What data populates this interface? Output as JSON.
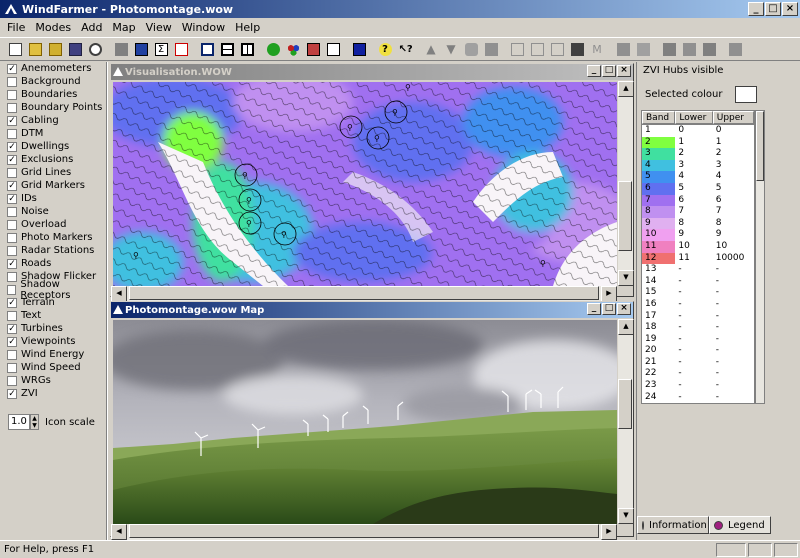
{
  "window": {
    "title": "WindFarmer - Photomontage.wow"
  },
  "menu": [
    "File",
    "Modes",
    "Add",
    "Map",
    "View",
    "Window",
    "Help"
  ],
  "layers": [
    {
      "label": "Anemometers",
      "checked": true
    },
    {
      "label": "Background",
      "checked": false
    },
    {
      "label": "Boundaries",
      "checked": false
    },
    {
      "label": "Boundary Points",
      "checked": false
    },
    {
      "label": "Cabling",
      "checked": true
    },
    {
      "label": "DTM",
      "checked": false
    },
    {
      "label": "Dwellings",
      "checked": true
    },
    {
      "label": "Exclusions",
      "checked": true
    },
    {
      "label": "Grid Lines",
      "checked": false
    },
    {
      "label": "Grid Markers",
      "checked": true
    },
    {
      "label": "IDs",
      "checked": true
    },
    {
      "label": "Noise",
      "checked": false
    },
    {
      "label": "Overload",
      "checked": false
    },
    {
      "label": "Photo Markers",
      "checked": false
    },
    {
      "label": "Radar Stations",
      "checked": false
    },
    {
      "label": "Roads",
      "checked": true
    },
    {
      "label": "Shadow Flicker",
      "checked": false
    },
    {
      "label": "Shadow Receptors",
      "checked": false
    },
    {
      "label": "Terrain",
      "checked": true
    },
    {
      "label": "Text",
      "checked": false
    },
    {
      "label": "Turbines",
      "checked": true
    },
    {
      "label": "Viewpoints",
      "checked": true
    },
    {
      "label": "Wind Energy",
      "checked": false
    },
    {
      "label": "Wind Speed",
      "checked": false
    },
    {
      "label": "WRGs",
      "checked": false
    },
    {
      "label": "ZVI",
      "checked": true
    }
  ],
  "icon_scale": {
    "value": "1.0",
    "label": "Icon scale"
  },
  "vis_window": {
    "title": "Visualisation.WOW"
  },
  "photo_window": {
    "title": "Photomontage.wow  Map"
  },
  "right_panel": {
    "zvi_label": "ZVI Hubs visible",
    "selected_colour_label": "Selected colour",
    "columns": [
      "Band",
      "Lower",
      "Upper"
    ],
    "rows": [
      {
        "band": "1",
        "lower": "0",
        "upper": "0",
        "color": "#ffffff"
      },
      {
        "band": "2",
        "lower": "1",
        "upper": "1",
        "color": "#80ff40"
      },
      {
        "band": "3",
        "lower": "2",
        "upper": "2",
        "color": "#40e0a0"
      },
      {
        "band": "4",
        "lower": "3",
        "upper": "3",
        "color": "#40c0e0"
      },
      {
        "band": "5",
        "lower": "4",
        "upper": "4",
        "color": "#4090f0"
      },
      {
        "band": "6",
        "lower": "5",
        "upper": "5",
        "color": "#6070f0"
      },
      {
        "band": "7",
        "lower": "6",
        "upper": "6",
        "color": "#a070f0"
      },
      {
        "band": "8",
        "lower": "7",
        "upper": "7",
        "color": "#c090f0"
      },
      {
        "band": "9",
        "lower": "8",
        "upper": "8",
        "color": "#e0b0f0"
      },
      {
        "band": "10",
        "lower": "9",
        "upper": "9",
        "color": "#f0a0f0"
      },
      {
        "band": "11",
        "lower": "10",
        "upper": "10",
        "color": "#f080c0"
      },
      {
        "band": "12",
        "lower": "11",
        "upper": "10000",
        "color": "#f07070"
      },
      {
        "band": "13",
        "lower": "-",
        "upper": "-",
        "color": "#ffffff"
      },
      {
        "band": "14",
        "lower": "-",
        "upper": "-",
        "color": "#ffffff"
      },
      {
        "band": "15",
        "lower": "-",
        "upper": "-",
        "color": "#ffffff"
      },
      {
        "band": "16",
        "lower": "-",
        "upper": "-",
        "color": "#ffffff"
      },
      {
        "band": "17",
        "lower": "-",
        "upper": "-",
        "color": "#ffffff"
      },
      {
        "band": "18",
        "lower": "-",
        "upper": "-",
        "color": "#ffffff"
      },
      {
        "band": "19",
        "lower": "-",
        "upper": "-",
        "color": "#ffffff"
      },
      {
        "band": "20",
        "lower": "-",
        "upper": "-",
        "color": "#ffffff"
      },
      {
        "band": "21",
        "lower": "-",
        "upper": "-",
        "color": "#ffffff"
      },
      {
        "band": "22",
        "lower": "-",
        "upper": "-",
        "color": "#ffffff"
      },
      {
        "band": "23",
        "lower": "-",
        "upper": "-",
        "color": "#ffffff"
      },
      {
        "band": "24",
        "lower": "-",
        "upper": "-",
        "color": "#ffffff"
      }
    ],
    "tabs": [
      {
        "label": "Information",
        "icon": "information-tab-icon",
        "color": "#2050c0"
      },
      {
        "label": "Legend",
        "icon": "legend-tab-icon",
        "color": "#a02080"
      }
    ]
  },
  "status": {
    "text": "For Help, press F1"
  }
}
